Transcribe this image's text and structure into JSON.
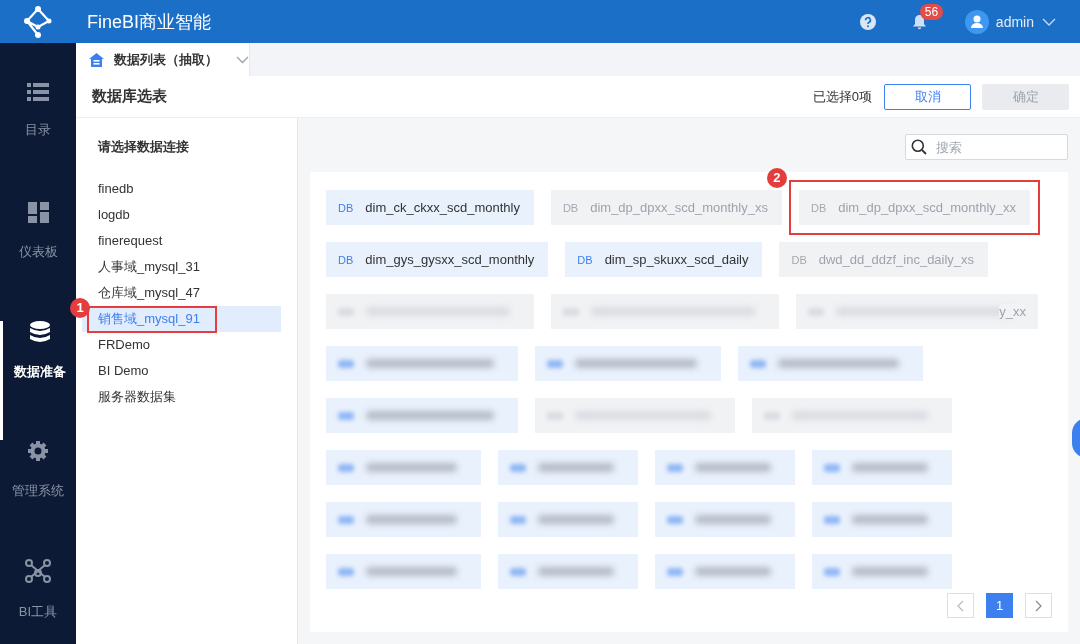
{
  "header": {
    "title": "FineBI商业智能",
    "notifications": "56",
    "user": "admin"
  },
  "nav": [
    {
      "label": "目录",
      "kind": "list",
      "selected": false
    },
    {
      "label": "仪表板",
      "kind": "dashboard",
      "selected": false
    },
    {
      "label": "数据准备",
      "kind": "database",
      "selected": true
    },
    {
      "label": "管理系统",
      "kind": "gear",
      "selected": false
    },
    {
      "label": "BI工具",
      "kind": "network",
      "selected": false
    }
  ],
  "tab": {
    "label": "数据列表（抽取）"
  },
  "page": {
    "title": "数据库选表",
    "selection": "已选择0项",
    "cancel": "取消",
    "confirm": "确定",
    "confirm_disabled": true
  },
  "connections": {
    "title": "请选择数据连接",
    "items": [
      {
        "label": "finedb",
        "selected": false
      },
      {
        "label": "logdb",
        "selected": false
      },
      {
        "label": "finerequest",
        "selected": false
      },
      {
        "label": "人事域_mysql_31",
        "selected": false
      },
      {
        "label": "仓库域_mysql_47",
        "selected": false
      },
      {
        "label": "销售域_mysql_91",
        "selected": true,
        "callout": "1"
      },
      {
        "label": "FRDemo",
        "selected": false
      },
      {
        "label": "BI Demo",
        "selected": false
      },
      {
        "label": "服务器数据集",
        "selected": false
      }
    ]
  },
  "search": {
    "placeholder": "搜索"
  },
  "tables": [
    [
      {
        "badge": "DB",
        "label": "dim_ck_ckxx_scd_monthly",
        "available": true,
        "blurred": false
      },
      {
        "badge": "DB",
        "label": "dim_dp_dpxx_scd_monthly_xs",
        "available": false,
        "blurred": false
      },
      {
        "badge": "DB",
        "label": "dim_dp_dpxx_scd_monthly_xx",
        "available": false,
        "blurred": false,
        "callout": "2"
      }
    ],
    [
      {
        "badge": "DB",
        "label": "dim_gys_gysxx_scd_monthly",
        "available": true,
        "blurred": false
      },
      {
        "badge": "DB",
        "label": "dim_sp_skuxx_scd_daily",
        "available": true,
        "blurred": false
      },
      {
        "badge": "DB",
        "label": "dwd_dd_ddzf_inc_daily_xs",
        "available": false,
        "blurred": false
      }
    ],
    [
      {
        "blurred": true,
        "available": false
      },
      {
        "blurred": true,
        "available": false
      },
      {
        "blurred": true,
        "available": false,
        "label": "y_xx"
      }
    ],
    [
      {
        "blurred": true,
        "available": true
      },
      {
        "blurred": true,
        "available": true
      },
      {
        "blurred": true,
        "available": true
      }
    ],
    [
      {
        "blurred": true,
        "available": true
      },
      {
        "blurred": true,
        "available": false
      },
      {
        "blurred": true,
        "available": false
      }
    ],
    [
      {
        "blurred": true,
        "available": true
      },
      {
        "blurred": true,
        "available": true
      },
      {
        "blurred": true,
        "available": true
      },
      {
        "blurred": true,
        "available": true
      }
    ],
    [
      {
        "blurred": true,
        "available": true
      },
      {
        "blurred": true,
        "available": true
      },
      {
        "blurred": true,
        "available": true
      },
      {
        "blurred": true,
        "available": true
      }
    ],
    [
      {
        "blurred": true,
        "available": true
      },
      {
        "blurred": true,
        "available": true
      },
      {
        "blurred": true,
        "available": true
      },
      {
        "blurred": true,
        "available": true
      }
    ]
  ],
  "pagination": {
    "prev_disabled": true,
    "pages": [
      {
        "label": "1",
        "selected": true
      }
    ],
    "next_disabled": false
  }
}
